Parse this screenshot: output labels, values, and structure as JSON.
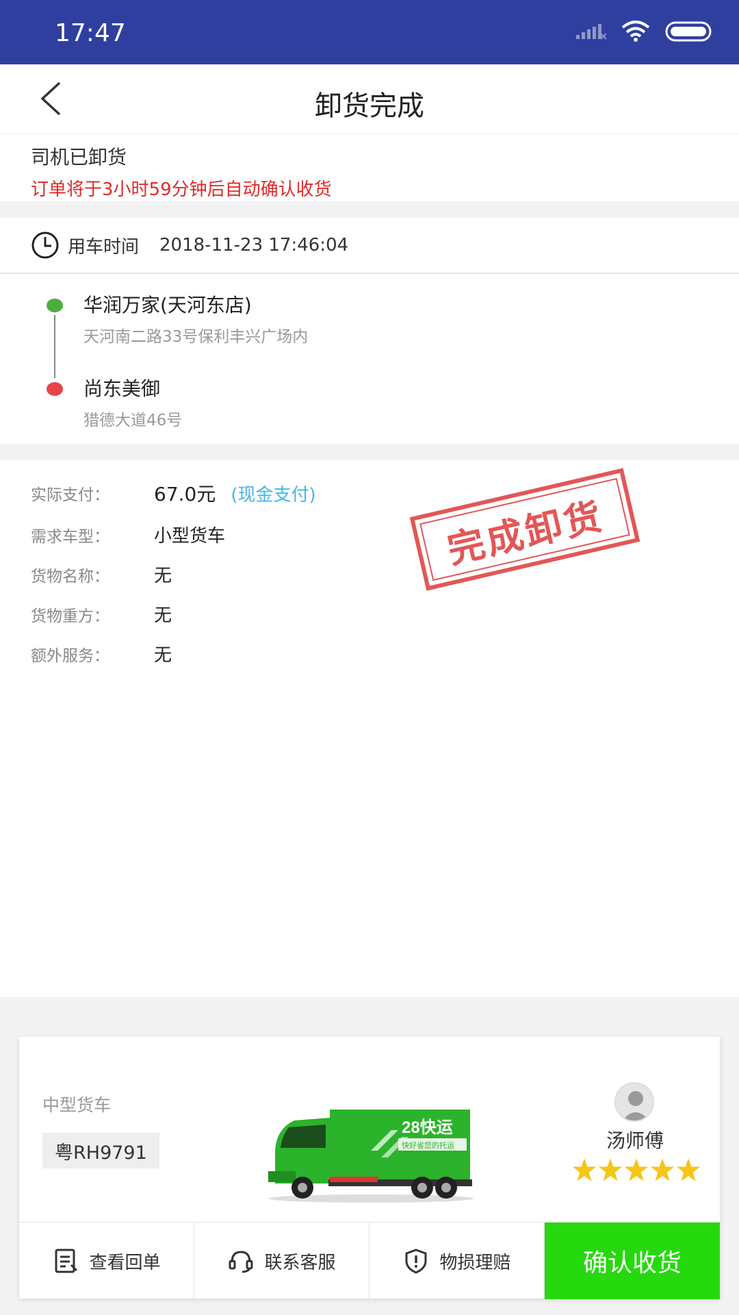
{
  "status_bar": {
    "time": "17:47"
  },
  "header": {
    "title": "卸货完成"
  },
  "order_status": {
    "main": "司机已卸货",
    "countdown": "订单将于3小时59分钟后自动确认收货"
  },
  "use_time": {
    "label": "用车时间",
    "value": "2018-11-23 17:46:04"
  },
  "route": {
    "start": {
      "name": "华润万家(天河东店)",
      "address": "天河南二路33号保利丰兴广场内"
    },
    "end": {
      "name": "尚东美御",
      "address": "猎德大道46号"
    }
  },
  "details": {
    "payment": {
      "label": "实际支付：",
      "value": "67.0元",
      "method": "(现金支付)"
    },
    "vehicle_required": {
      "label": "需求车型：",
      "value": "小型货车"
    },
    "cargo_name": {
      "label": "货物名称：",
      "value": "无"
    },
    "cargo_weight": {
      "label": "货物重方：",
      "value": "无"
    },
    "extra_service": {
      "label": "额外服务：",
      "value": "无"
    }
  },
  "stamp": {
    "text": "完成卸货"
  },
  "driver": {
    "truck_type": "中型货车",
    "plate": "粤RH9791",
    "name": "汤师傅",
    "rating": 5,
    "truck_brand": "28快运",
    "truck_slogan": "快好省您的托运"
  },
  "actions": {
    "view_receipt": "查看回单",
    "contact_service": "联系客服",
    "damage_claim": "物损理赔",
    "confirm_receipt": "确认收货"
  },
  "colors": {
    "status_bar": "#2f3fa0",
    "warning_red": "#e02a2a",
    "start_dot": "#4caf3c",
    "end_dot": "#e8434a",
    "pay_method_blue": "#46b5ea",
    "confirm_green": "#26d90e",
    "star_yellow": "#f5c518"
  }
}
